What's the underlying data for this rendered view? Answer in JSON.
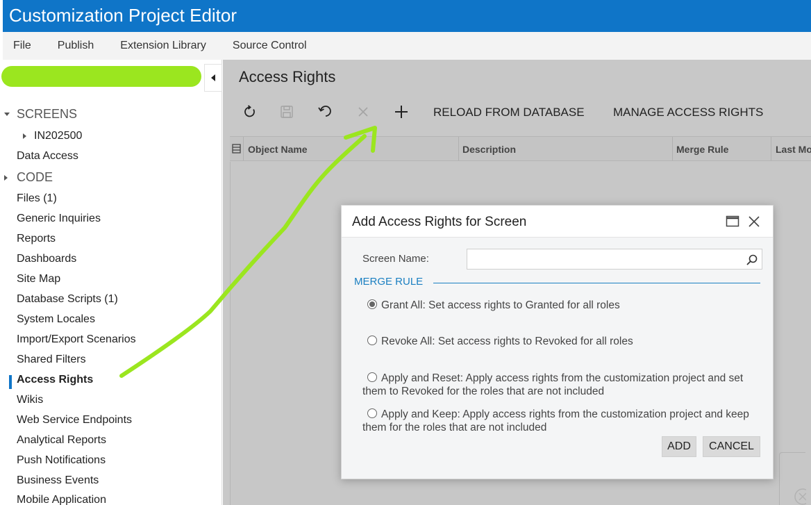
{
  "app": {
    "title": "Customization Project Editor"
  },
  "menu": [
    "File",
    "Publish",
    "Extension Library",
    "Source Control"
  ],
  "sidebar": {
    "screens_label": "SCREENS",
    "screen_child": "IN202500",
    "data_access": "Data Access",
    "code_label": "CODE",
    "items": [
      "Files (1)",
      "Generic Inquiries",
      "Reports",
      "Dashboards",
      "Site Map",
      "Database Scripts (1)",
      "System Locales",
      "Import/Export Scenarios",
      "Shared Filters",
      "Access Rights",
      "Wikis",
      "Web Service Endpoints",
      "Analytical Reports",
      "Push Notifications",
      "Business Events",
      "Mobile Application"
    ],
    "active_item": "Access Rights"
  },
  "page": {
    "title": "Access Rights",
    "toolbar": {
      "icons": [
        "refresh-icon",
        "save-icon",
        "undo-icon",
        "delete-icon",
        "add-icon"
      ],
      "reload": "RELOAD FROM DATABASE",
      "manage": "MANAGE ACCESS RIGHTS"
    },
    "grid": {
      "columns": [
        "Object Name",
        "Description",
        "Merge Rule",
        "Last Mo"
      ]
    }
  },
  "dialog": {
    "title": "Add Access Rights for Screen",
    "field_label": "Screen Name:",
    "field_value": "",
    "section": "MERGE RULE",
    "options": [
      {
        "label": "Grant All: Set access rights to Granted for all roles",
        "checked": true
      },
      {
        "label": "Revoke All: Set access rights to Revoked for all roles",
        "checked": false
      },
      {
        "label": "Apply and Reset: Apply access rights from the customization project and set them to Revoked for the roles that are not included",
        "checked": false
      },
      {
        "label": "Apply and Keep: Apply access rights from the customization project and keep them for the roles that are not included",
        "checked": false
      }
    ],
    "add_label": "ADD",
    "cancel_label": "CANCEL"
  },
  "colors": {
    "brand": "#0f75c8",
    "highlight": "#9be61f",
    "section": "#1a7fc1"
  }
}
